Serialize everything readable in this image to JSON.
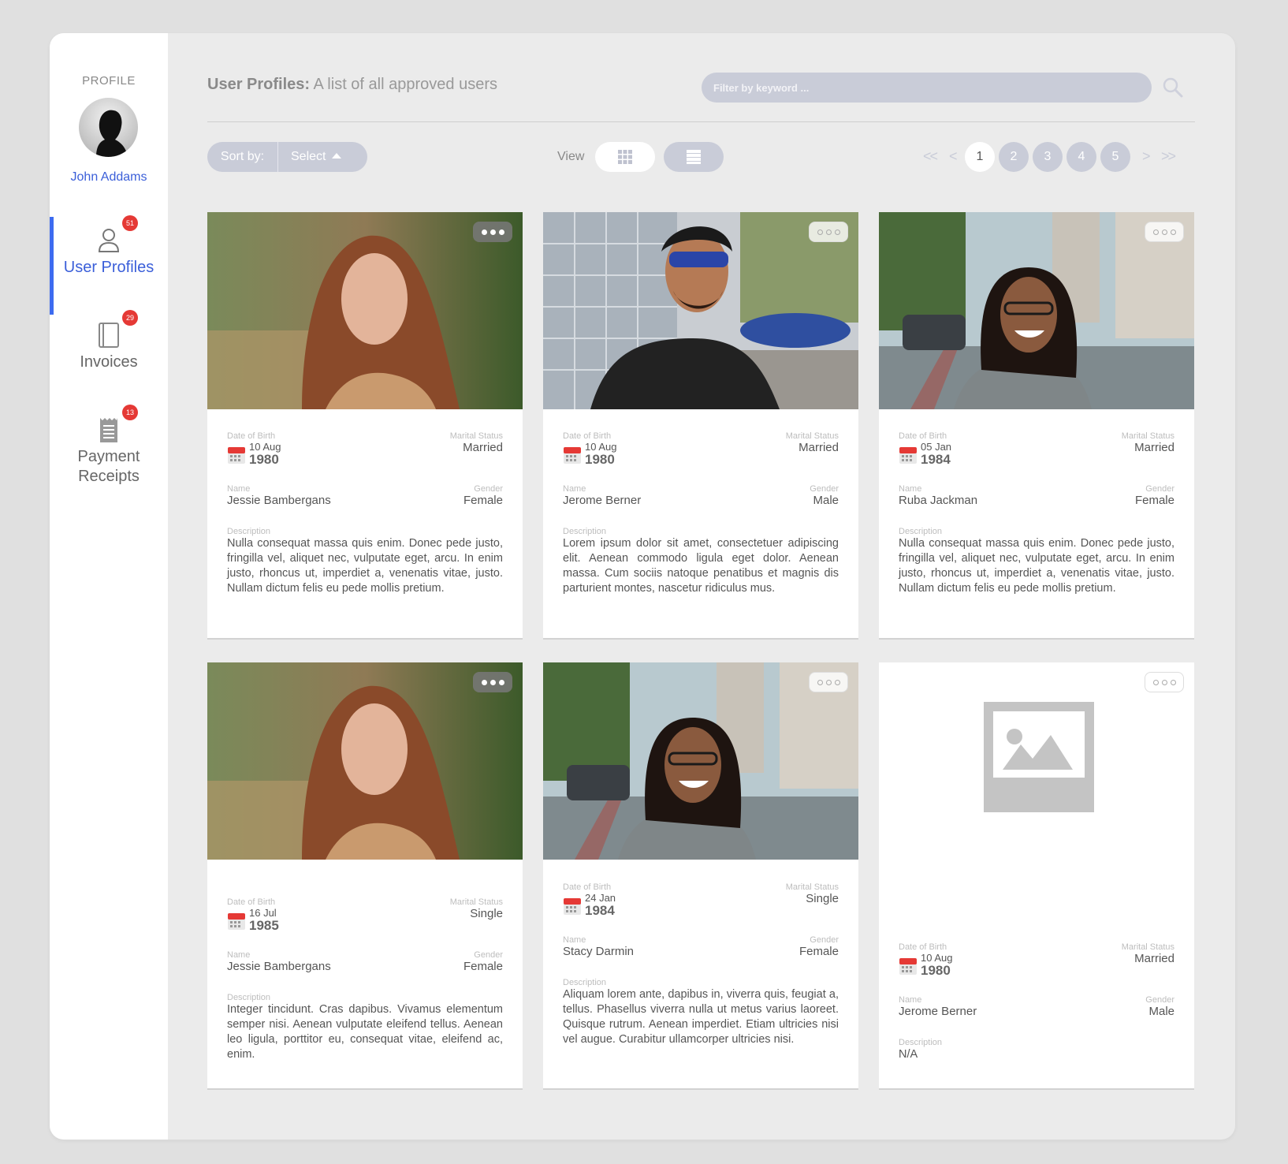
{
  "sidebar": {
    "profile_label": "PROFILE",
    "user_name": "John Addams",
    "items": [
      {
        "label": "User Profiles",
        "badge": "51",
        "icon": "user-icon",
        "active": true
      },
      {
        "label": "Invoices",
        "badge": "29",
        "icon": "invoice-icon",
        "active": false
      },
      {
        "label": "Payment\nReceipts",
        "badge": "13",
        "icon": "receipt-icon",
        "active": false
      }
    ]
  },
  "header": {
    "title_bold": "User Profiles:",
    "title_rest": " A list of all approved users",
    "search_placeholder": "Filter by keyword ..."
  },
  "controls": {
    "sort_label": "Sort by:",
    "sort_value": "Select",
    "view_label": "View",
    "pager": {
      "first": "<<",
      "prev": "<",
      "next": ">",
      "last": ">>",
      "pages": [
        "1",
        "2",
        "3",
        "4",
        "5"
      ],
      "current": "1"
    }
  },
  "labels": {
    "dob": "Date of Birth",
    "marital": "Marital Status",
    "name": "Name",
    "gender": "Gender",
    "description": "Description"
  },
  "cards": [
    {
      "dob_dm": "10 Aug",
      "dob_y": "1980",
      "marital": "Married",
      "name": "Jessie Bambergans",
      "gender": "Female",
      "description": "Nulla consequat massa quis enim. Donec pede justo, fringilla vel, aliquet nec, vulputate eget, arcu. In enim justo, rhoncus ut, imperdiet a, venenatis vitae, justo. Nullam dictum felis eu pede mollis pretium."
    },
    {
      "dob_dm": "10 Aug",
      "dob_y": "1980",
      "marital": "Married",
      "name": "Jerome Berner",
      "gender": "Male",
      "description": "Lorem ipsum dolor sit amet, consectetuer adipiscing elit. Aenean commodo ligula eget dolor. Aenean massa. Cum sociis natoque penatibus et magnis dis parturient montes, nascetur ridiculus mus."
    },
    {
      "dob_dm": "05 Jan",
      "dob_y": "1984",
      "marital": "Married",
      "name": "Ruba Jackman",
      "gender": "Female",
      "description": "Nulla consequat massa quis enim. Donec pede justo, fringilla vel, aliquet nec, vulputate eget, arcu. In enim justo, rhoncus ut, imperdiet a, venenatis vitae, justo. Nullam dictum felis eu pede mollis pretium."
    },
    {
      "dob_dm": "16 Jul",
      "dob_y": "1985",
      "marital": "Single",
      "name": "Jessie Bambergans",
      "gender": "Female",
      "description": "Integer tincidunt. Cras dapibus. Vivamus elementum semper nisi. Aenean vulputate eleifend tellus. Aenean leo ligula, porttitor eu, consequat vitae, eleifend ac, enim."
    },
    {
      "dob_dm": "24 Jan",
      "dob_y": "1984",
      "marital": "Single",
      "name": "Stacy Darmin",
      "gender": "Female",
      "description": "Aliquam lorem ante, dapibus in, viverra quis, feugiat a, tellus. Phasellus viverra nulla ut metus varius laoreet. Quisque rutrum. Aenean imperdiet. Etiam ultricies nisi vel augue. Curabitur ullamcorper ultricies nisi."
    },
    {
      "dob_dm": "10 Aug",
      "dob_y": "1980",
      "marital": "Married",
      "name": "Jerome Berner",
      "gender": "Male",
      "description": "N/A"
    }
  ]
}
